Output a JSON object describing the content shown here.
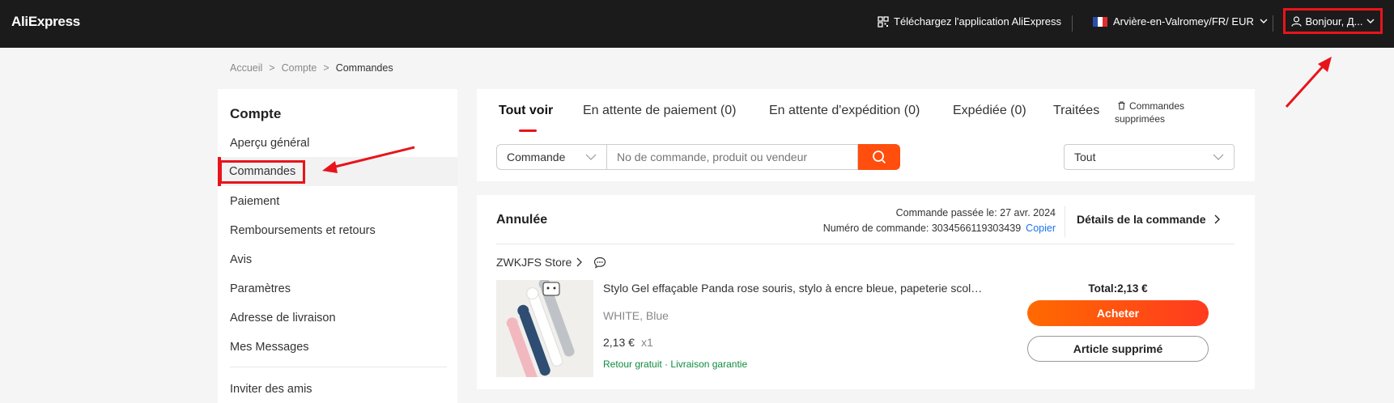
{
  "header": {
    "logo": "AliExpress",
    "app_download": "Téléchargez l'application AliExpress",
    "region": "Arvière-en-Valromey/FR/ EUR",
    "account": "Bonjour, Д...",
    "icons": [
      "qr-code-icon",
      "france-flag-icon",
      "chevron-down-icon",
      "user-icon"
    ]
  },
  "breadcrumb": {
    "items": [
      "Accueil",
      "Compte",
      "Commandes"
    ],
    "separator": ">"
  },
  "sidebar": {
    "title": "Compte",
    "items": [
      {
        "label": "Aperçu général"
      },
      {
        "label": "Commandes"
      },
      {
        "label": "Paiement"
      },
      {
        "label": "Remboursements et retours"
      },
      {
        "label": "Avis"
      },
      {
        "label": "Paramètres"
      },
      {
        "label": "Adresse de livraison"
      },
      {
        "label": "Mes Messages"
      },
      {
        "label": "Inviter des amis"
      }
    ],
    "active": "Commandes"
  },
  "tabs": {
    "items": [
      {
        "label": "Tout voir"
      },
      {
        "label": "En attente de paiement (0)"
      },
      {
        "label": "En attente d'expédition (0)"
      },
      {
        "label": "Expédiée (0)"
      },
      {
        "label": "Traitées"
      }
    ],
    "active": "Tout voir",
    "deleted_orders": "Commandes supprimées"
  },
  "search": {
    "type_value": "Commande",
    "placeholder": "No de commande, produit ou vendeur",
    "filter_value": "Tout"
  },
  "order": {
    "status": "Annulée",
    "placed_label": "Commande passée le: 27 avr. 2024",
    "number_label": "Numéro de commande: 3034566119303439",
    "copy": "Copier",
    "details": "Détails de la commande",
    "store": "ZWKJFS Store",
    "product_title": "Stylo Gel effaçable Panda rose souris, stylo à encre bleue, papeterie scolaire",
    "variant": "WHITE, Blue",
    "price": "2,13 €",
    "quantity": "x1",
    "free_return": "Retour gratuit",
    "guarantee_sep": "·",
    "delivery_guarantee": "Livraison garantie",
    "total": "Total:2,13 €",
    "buy_again": "Acheter",
    "item_deleted": "Article supprimé"
  },
  "colors": {
    "accent": "#e8141b",
    "orange": "#ff4e0e",
    "header_bg": "#1b1b1b",
    "link_blue": "#1a73e8",
    "green": "#118a3e"
  }
}
